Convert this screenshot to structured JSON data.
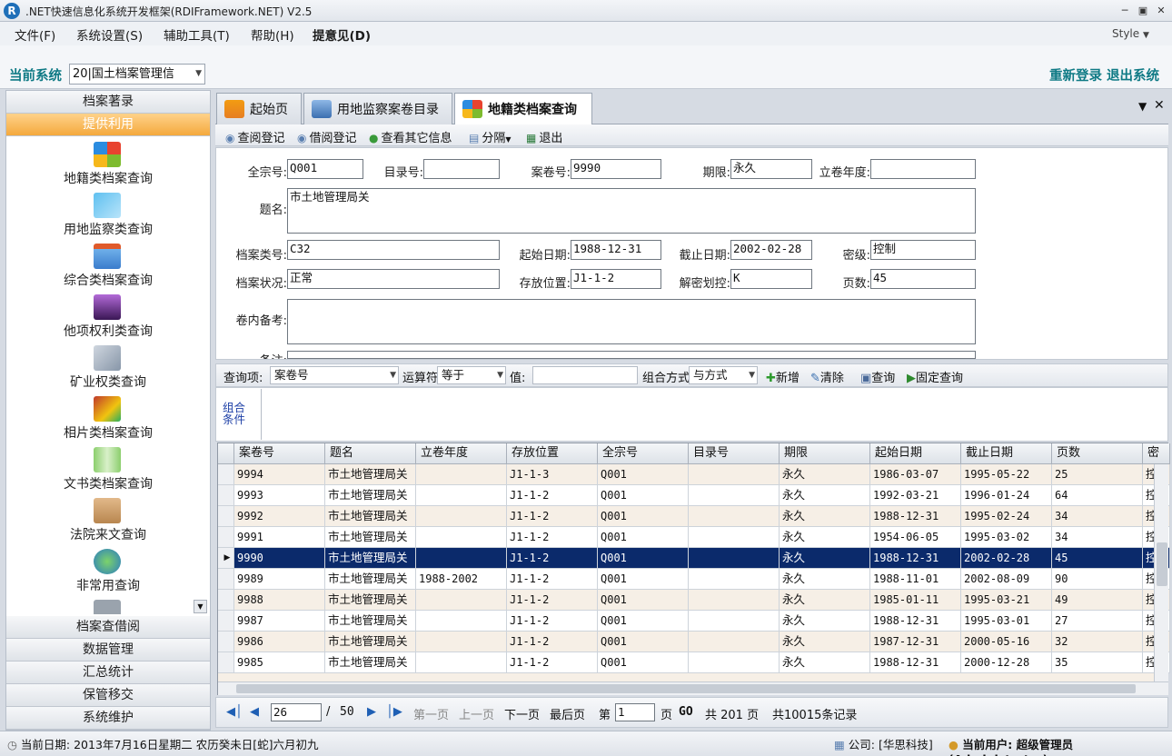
{
  "window": {
    "title": ".NET快速信息化系统开发框架(RDIFramework.NET) V2.5",
    "icon_letter": "R"
  },
  "menu": {
    "items": [
      "文件(F)",
      "系统设置(S)",
      "辅助工具(T)",
      "帮助(H)",
      "提意见(D)"
    ],
    "style_label": "Style"
  },
  "system": {
    "label": "当前系统",
    "selected": "20|国土档案管理信",
    "relogin": "重新登录",
    "exit": "退出系统"
  },
  "nav": {
    "headers_top": [
      "档案著录",
      "提供利用"
    ],
    "items": [
      "地籍类档案查询",
      "用地监察类查询",
      "综合类档案查询",
      "他项权利类查询",
      "矿业权类查询",
      "相片类档案查询",
      "文书类档案查询",
      "法院来文查询",
      "非常用查询"
    ],
    "headers_bottom": [
      "档案查借阅",
      "数据管理",
      "汇总统计",
      "保管移交",
      "系统维护"
    ]
  },
  "tabs": [
    "起始页",
    "用地监察案卷目录",
    "地籍类档案查询"
  ],
  "toolbar": {
    "items": [
      "查阅登记",
      "借阅登记",
      "查看其它信息",
      "分隔",
      "退出"
    ]
  },
  "form": {
    "labels": {
      "qzh": "全宗号:",
      "mlh": "目录号:",
      "ajh": "案卷号:",
      "qx": "期限:",
      "ljnd": "立卷年度:",
      "tm": "题名:",
      "dalh": "档案类号:",
      "qsrq": "起始日期:",
      "jzrq": "截止日期:",
      "mj": "密级:",
      "dazk": "档案状况:",
      "cfwz": "存放位置:",
      "jmhk": "解密划控:",
      "ys": "页数:",
      "jnbk": "卷内备考:",
      "bz": "备注:"
    },
    "values": {
      "qzh": "Q001",
      "mlh": "",
      "ajh": "9990",
      "qx": "永久",
      "ljnd": "",
      "tm": "市土地管理局关",
      "dalh": "C32",
      "qsrq": "1988-12-31",
      "jzrq": "2002-02-28",
      "mj": "控制",
      "dazk": "正常",
      "cfwz": "J1-1-2",
      "jmhk": "K",
      "ys": "45",
      "jnbk": "",
      "bz": ""
    }
  },
  "query": {
    "label_item": "查询项:",
    "item": "案卷号",
    "label_op": "运算符",
    "op": "等于",
    "label_val": "值:",
    "label_combine": "组合方式",
    "combine": "与方式",
    "add": "新增",
    "clear": "清除",
    "search": "查询",
    "fixed": "固定查询",
    "combo_label": "组合条件"
  },
  "grid": {
    "columns": [
      "案卷号",
      "题名",
      "立卷年度",
      "存放位置",
      "全宗号",
      "目录号",
      "期限",
      "起始日期",
      "截止日期",
      "页数",
      "密"
    ],
    "rows": [
      [
        "9994",
        "市土地管理局关",
        "",
        "J1-1-3",
        "Q001",
        "",
        "永久",
        "1986-03-07",
        "1995-05-22",
        "25",
        "控"
      ],
      [
        "9993",
        "市土地管理局关",
        "",
        "J1-1-2",
        "Q001",
        "",
        "永久",
        "1992-03-21",
        "1996-01-24",
        "64",
        "控"
      ],
      [
        "9992",
        "市土地管理局关",
        "",
        "J1-1-2",
        "Q001",
        "",
        "永久",
        "1988-12-31",
        "1995-02-24",
        "34",
        "控"
      ],
      [
        "9991",
        "市土地管理局关",
        "",
        "J1-1-2",
        "Q001",
        "",
        "永久",
        "1954-06-05",
        "1995-03-02",
        "34",
        "控"
      ],
      [
        "9990",
        "市土地管理局关",
        "",
        "J1-1-2",
        "Q001",
        "",
        "永久",
        "1988-12-31",
        "2002-02-28",
        "45",
        "控"
      ],
      [
        "9989",
        "市土地管理局关",
        "1988-2002",
        "J1-1-2",
        "Q001",
        "",
        "永久",
        "1988-11-01",
        "2002-08-09",
        "90",
        "控"
      ],
      [
        "9988",
        "市土地管理局关",
        "",
        "J1-1-2",
        "Q001",
        "",
        "永久",
        "1985-01-11",
        "1995-03-21",
        "49",
        "控"
      ],
      [
        "9987",
        "市土地管理局关",
        "",
        "J1-1-2",
        "Q001",
        "",
        "永久",
        "1988-12-31",
        "1995-03-01",
        "27",
        "控"
      ],
      [
        "9986",
        "市土地管理局关",
        "",
        "J1-1-2",
        "Q001",
        "",
        "永久",
        "1987-12-31",
        "2000-05-16",
        "32",
        "控"
      ],
      [
        "9985",
        "市土地管理局关",
        "",
        "J1-1-2",
        "Q001",
        "",
        "永久",
        "1988-12-31",
        "2000-12-28",
        "35",
        "控"
      ]
    ],
    "selected_row": 4
  },
  "pager": {
    "current": "26",
    "sep": "/",
    "total_pages": "50",
    "first": "第一页",
    "prev": "上一页",
    "next": "下一页",
    "last": "最后页",
    "goto_prefix": "第",
    "goto_value": "1",
    "goto_suffix": "页",
    "go": "GO",
    "summary_pages": "共 201 页",
    "summary_records": "共10015条记录"
  },
  "status": {
    "date": "当前日期: 2013年7月16日星期二 农历癸未日[蛇]六月初九",
    "company": "公司: [华思科技]",
    "user": "当前用户: 超级管理员(Administrator)"
  },
  "colors": {
    "accent": "#0f7a85",
    "selected_row": "#0b2a6b",
    "row_alt": "#f6efe6",
    "nav_active": "#f4a93d"
  }
}
